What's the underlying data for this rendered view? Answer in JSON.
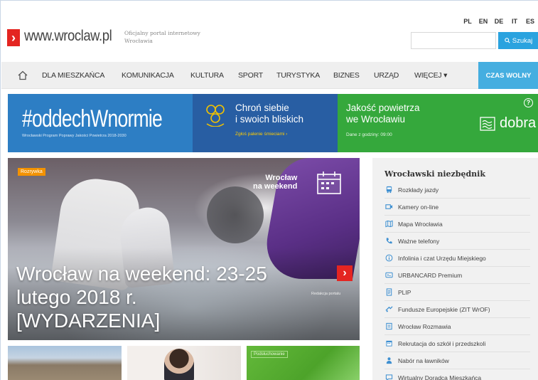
{
  "header": {
    "logo_mark": "›",
    "logo_text": "www.wroclaw.pl",
    "logo_subtitle": "Oficjalny portal internetowy Wrocławia",
    "languages": [
      "PL",
      "EN",
      "DE",
      "IT",
      "ES"
    ],
    "active_language": "PL",
    "search": {
      "placeholder": "",
      "button_label": "Szukaj"
    }
  },
  "nav": {
    "items": [
      "DLA MIESZKAŃCA",
      "KOMUNIKACJA",
      "KULTURA",
      "SPORT",
      "TURYSTYKA",
      "BIZNES",
      "URZĄD",
      "WIĘCEJ ▾"
    ],
    "cta": "CZAS WOLNY"
  },
  "banner": {
    "hashtag": "#oddechWnormie",
    "hashtag_sub": "Wrocławski Program Poprawy Jakości Powietrza 2018-2030",
    "protect_title_1": "Chroń siebie",
    "protect_title_2": "i swoich bliskich",
    "protect_link": "Zgłoś palenie śmieciami  ›",
    "air_title_1": "Jakość powietrza",
    "air_title_2": "we Wrocławiu",
    "air_sub": "Dane z godziny: 09:00",
    "air_status": "dobra",
    "help": "?"
  },
  "hero": {
    "badge": "Rozrywka",
    "weekend_1": "Wrocław",
    "weekend_2": "na weekend",
    "title": "Wrocław na weekend: 23-25 lutego 2018 r. [WYDARZENIA]",
    "arrow": "›",
    "credit": "Redakcja portalu"
  },
  "thumbs": {
    "t3_tag": "Podsłuchowanie"
  },
  "sidebar": {
    "title": "Wrocławski niezbędnik",
    "items": [
      {
        "label": "Rozkłady jazdy",
        "icon": "bus-icon"
      },
      {
        "label": "Kamery on-line",
        "icon": "camera-icon"
      },
      {
        "label": "Mapa Wrocławia",
        "icon": "map-icon"
      },
      {
        "label": "Ważne telefony",
        "icon": "phone-icon"
      },
      {
        "label": "Infolinia i czat Urzędu Miejskiego",
        "icon": "info-icon"
      },
      {
        "label": "URBANCARD Premium",
        "icon": "card-icon"
      },
      {
        "label": "PLIP",
        "icon": "document-icon"
      },
      {
        "label": "Fundusze Europejskie (ZIT WrOF)",
        "icon": "eu-icon"
      },
      {
        "label": "Wrocław Rozmawia",
        "icon": "chat-doc-icon"
      },
      {
        "label": "Rekrutacja do szkół i przedszkoli",
        "icon": "calendar-icon"
      },
      {
        "label": "Nabór na ławników",
        "icon": "person-icon"
      },
      {
        "label": "Wirtualny Doradca Mieszkańca",
        "icon": "speech-icon"
      }
    ]
  },
  "colors": {
    "brand_red": "#e42521",
    "accent_blue": "#2aa3df",
    "banner_blue": "#2d7ec4",
    "banner_navy": "#285ea3",
    "banner_green": "#35a83c",
    "sidebar_icon": "#3d8fd1"
  }
}
